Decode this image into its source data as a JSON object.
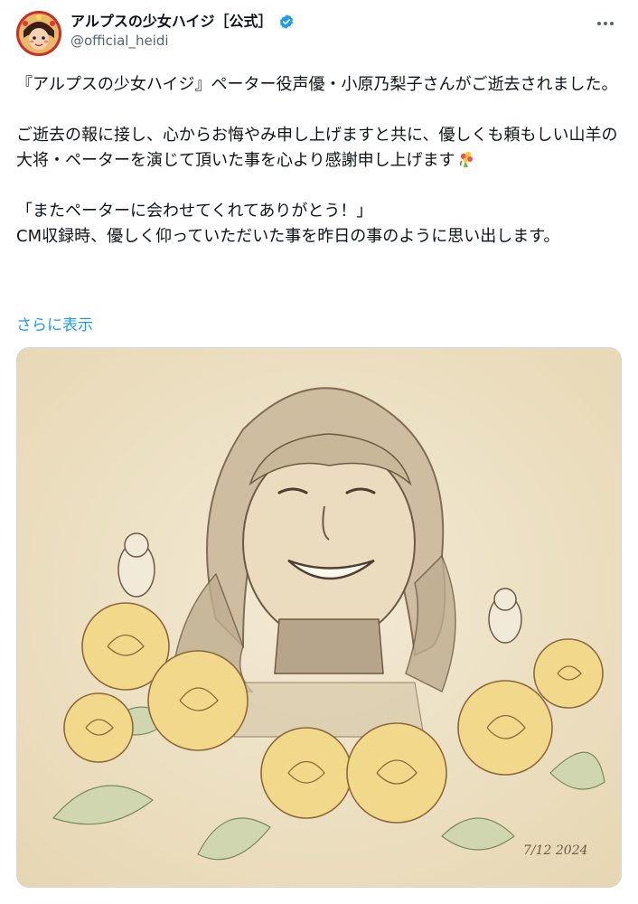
{
  "account": {
    "display_name": "アルプスの少女ハイジ［公式］",
    "handle": "@official_heidi",
    "verified": true
  },
  "tweet": {
    "line1": "『アルプスの少女ハイジ』ペーター役声優・小原乃梨子さんがご逝去されました。",
    "para2": "ご逝去の報に接し、心からお悔やみ申し上げますと共に、優しくも頼もしい山羊の大将・ペーターを演じて頂いた事を心より感謝申し上げます",
    "quote": "「またペーターに会わせてくれてありがとう！」",
    "para4": "CM収録時、優しく仰っていただいた事を昨日の事のように思い出します。",
    "show_more": "さらに表示"
  },
  "media": {
    "description": "illustration",
    "signature": "7/12 2024"
  },
  "icons": [
    "avatar",
    "verified-badge-icon",
    "more-options-icon",
    "bouquet-emoji-icon"
  ],
  "colors": {
    "link": "#1d9bf0",
    "verified": "#1d9bf0",
    "paper": "#efe3c8"
  }
}
